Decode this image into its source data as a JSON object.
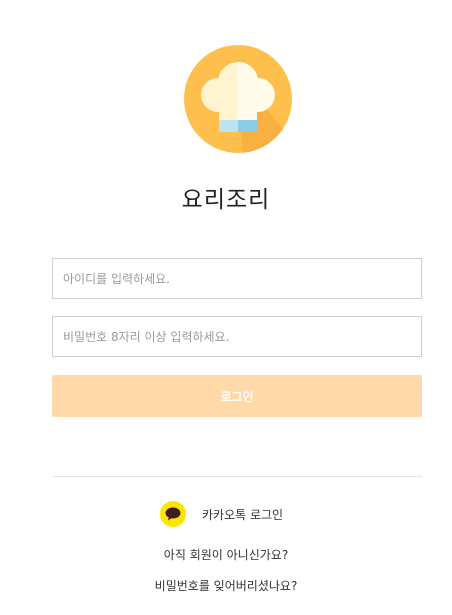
{
  "app": {
    "title": "요리조리"
  },
  "icons": {
    "logo": "chef-hat-icon",
    "kakao": "kakao-chat-icon"
  },
  "form": {
    "id_placeholder": "아이디를 입력하세요.",
    "id_value": "",
    "password_placeholder": "비밀번호 8자리 이상 입력하세요.",
    "password_value": "",
    "login_label": "로그인"
  },
  "social": {
    "kakao_label": "카카오톡 로그인"
  },
  "links": {
    "signup": "아직 회원이 아니신가요?",
    "forgot_password": "비밀번호를 잊어버리셨나요?"
  },
  "colors": {
    "logo_circle": "#ffbf4d",
    "login_button": "#ffd9a8",
    "kakao_yellow": "#fee500",
    "kakao_bubble": "#3c1e1e"
  }
}
